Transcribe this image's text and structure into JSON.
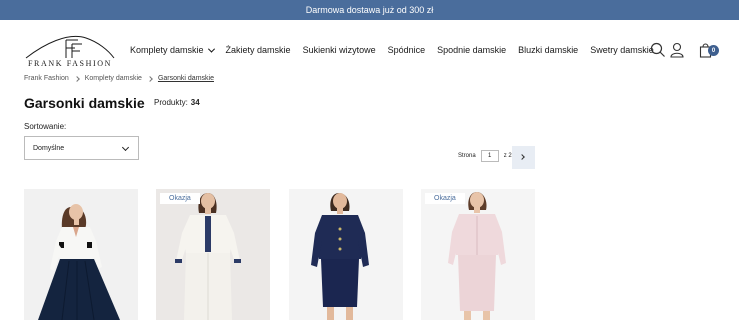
{
  "topbar": {
    "text": "Darmowa dostawa już od 300 zł"
  },
  "logo": {
    "text": "FRANK FASHION"
  },
  "nav": {
    "items": [
      {
        "label": "Komplety damskie",
        "has_dropdown": true
      },
      {
        "label": "Żakiety damskie"
      },
      {
        "label": "Sukienki wizytowe"
      },
      {
        "label": "Spódnice"
      },
      {
        "label": "Spodnie damskie"
      },
      {
        "label": "Bluzki damskie"
      },
      {
        "label": "Swetry damskie"
      }
    ]
  },
  "header_icons": {
    "search": "search-icon",
    "account": "user-icon",
    "cart": "bag-icon",
    "cart_count": "0"
  },
  "breadcrumb": {
    "items": [
      "Frank Fashion",
      "Komplety damskie",
      "Garsonki damskie"
    ]
  },
  "page": {
    "title": "Garsonki damskie",
    "products_label": "Produkty:",
    "products_count": "34"
  },
  "sort": {
    "label": "Sortowanie:",
    "value": "Domyślne"
  },
  "pagination": {
    "label": "Strona",
    "current": "1",
    "of": "z 2"
  },
  "products": [
    {
      "badge": "",
      "image": "woman-white-jacket-navy-pleated-skirt"
    },
    {
      "badge": "Okazja",
      "image": "woman-white-boucle-suit-navy-trim"
    },
    {
      "badge": "",
      "image": "woman-navy-skirt-suit"
    },
    {
      "badge": "Okazja",
      "image": "woman-pale-pink-suit"
    }
  ],
  "colors": {
    "topbar": "#4a6d9c",
    "accent": "#3e5f8f",
    "badge_text": "#4a6d9c"
  }
}
